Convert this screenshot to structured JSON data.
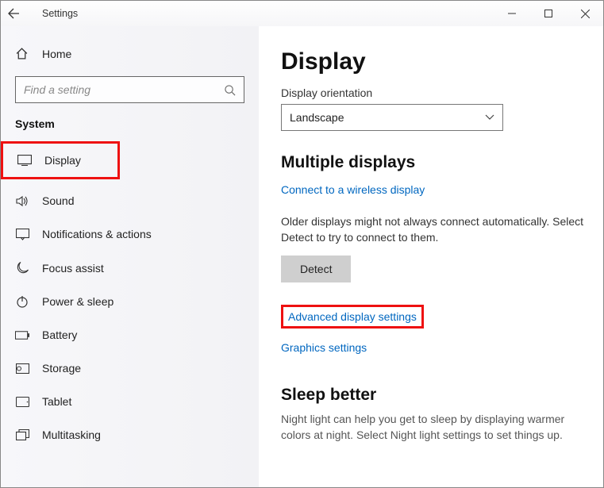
{
  "titlebar": {
    "title": "Settings"
  },
  "sidebar": {
    "home": "Home",
    "search_placeholder": "Find a setting",
    "section": "System",
    "items": [
      {
        "label": "Display"
      },
      {
        "label": "Sound"
      },
      {
        "label": "Notifications & actions"
      },
      {
        "label": "Focus assist"
      },
      {
        "label": "Power & sleep"
      },
      {
        "label": "Battery"
      },
      {
        "label": "Storage"
      },
      {
        "label": "Tablet"
      },
      {
        "label": "Multitasking"
      }
    ]
  },
  "main": {
    "heading": "Display",
    "orientation_label": "Display orientation",
    "orientation_value": "Landscape",
    "multi_heading": "Multiple displays",
    "connect_link": "Connect to a wireless display",
    "detect_text": "Older displays might not always connect automatically. Select Detect to try to connect to them.",
    "detect_button": "Detect",
    "advanced_link": "Advanced display settings",
    "graphics_link": "Graphics settings",
    "sleep_heading": "Sleep better",
    "sleep_desc": "Night light can help you get to sleep by displaying warmer colors at night. Select Night light settings to set things up."
  }
}
